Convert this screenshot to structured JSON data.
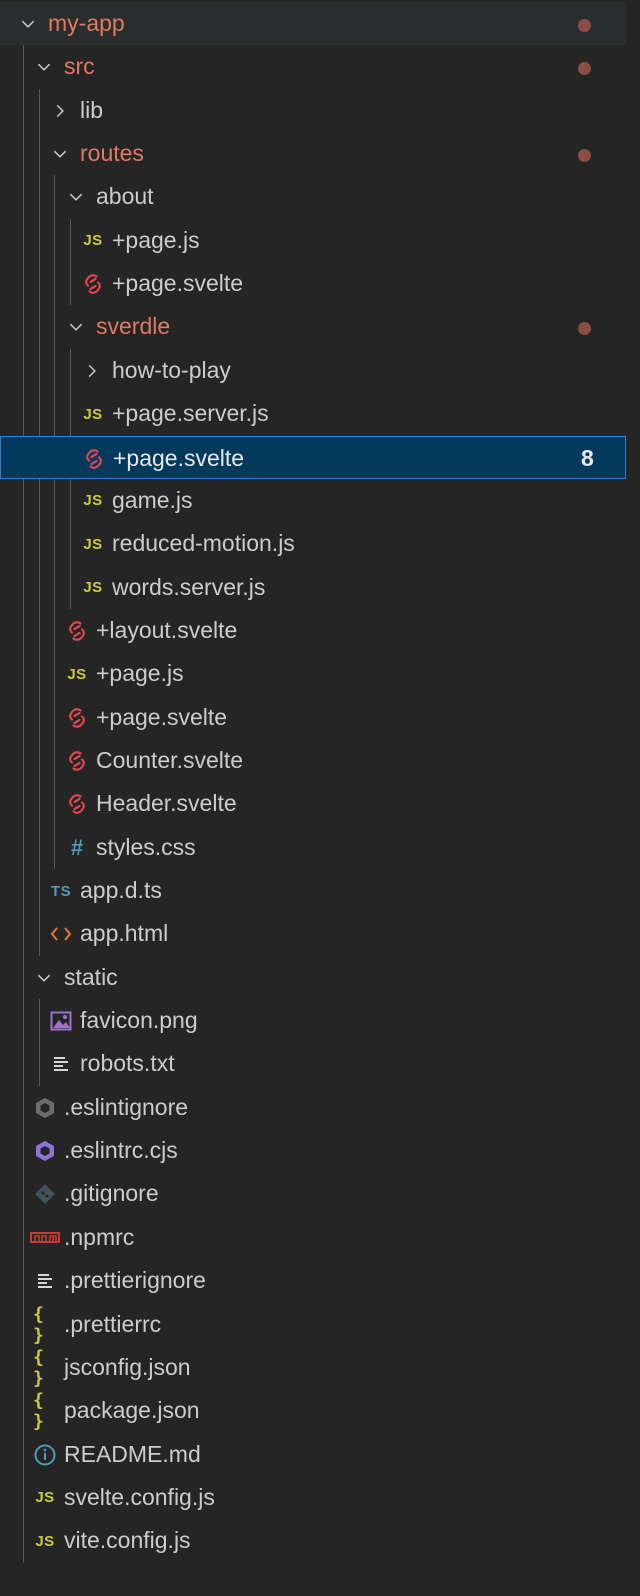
{
  "explorer": {
    "items": [
      {
        "label": "my-app",
        "icon": "chevron-down-icon",
        "kind": "folder-open",
        "modified": true,
        "dot": true
      },
      {
        "label": "src",
        "icon": "chevron-down-icon",
        "kind": "folder-open",
        "modified": true,
        "dot": true
      },
      {
        "label": "lib",
        "icon": "chevron-right-icon",
        "kind": "folder-closed"
      },
      {
        "label": "routes",
        "icon": "chevron-down-icon",
        "kind": "folder-open",
        "modified": true,
        "dot": true
      },
      {
        "label": "about",
        "icon": "chevron-down-icon",
        "kind": "folder-open"
      },
      {
        "label": "+page.js",
        "icon": "js-file-icon",
        "kind": "file"
      },
      {
        "label": "+page.svelte",
        "icon": "svelte-file-icon",
        "kind": "file"
      },
      {
        "label": "sverdle",
        "icon": "chevron-down-icon",
        "kind": "folder-open",
        "modified": true,
        "dot": true
      },
      {
        "label": "how-to-play",
        "icon": "chevron-right-icon",
        "kind": "folder-closed"
      },
      {
        "label": "+page.server.js",
        "icon": "js-file-icon",
        "kind": "file"
      },
      {
        "label": "+page.svelte",
        "icon": "svelte-file-icon",
        "kind": "file",
        "selected": true,
        "badge": "8"
      },
      {
        "label": "game.js",
        "icon": "js-file-icon",
        "kind": "file"
      },
      {
        "label": "reduced-motion.js",
        "icon": "js-file-icon",
        "kind": "file"
      },
      {
        "label": "words.server.js",
        "icon": "js-file-icon",
        "kind": "file"
      },
      {
        "label": "+layout.svelte",
        "icon": "svelte-file-icon",
        "kind": "file"
      },
      {
        "label": "+page.js",
        "icon": "js-file-icon",
        "kind": "file"
      },
      {
        "label": "+page.svelte",
        "icon": "svelte-file-icon",
        "kind": "file"
      },
      {
        "label": "Counter.svelte",
        "icon": "svelte-file-icon",
        "kind": "file"
      },
      {
        "label": "Header.svelte",
        "icon": "svelte-file-icon",
        "kind": "file"
      },
      {
        "label": "styles.css",
        "icon": "css-file-icon",
        "kind": "file"
      },
      {
        "label": "app.d.ts",
        "icon": "ts-file-icon",
        "kind": "file"
      },
      {
        "label": "app.html",
        "icon": "html-file-icon",
        "kind": "file"
      },
      {
        "label": "static",
        "icon": "chevron-down-icon",
        "kind": "folder-open"
      },
      {
        "label": "favicon.png",
        "icon": "image-file-icon",
        "kind": "file"
      },
      {
        "label": "robots.txt",
        "icon": "text-file-icon",
        "kind": "file"
      },
      {
        "label": ".eslintignore",
        "icon": "eslint-ignore-icon",
        "kind": "file"
      },
      {
        "label": ".eslintrc.cjs",
        "icon": "eslint-icon",
        "kind": "file"
      },
      {
        "label": ".gitignore",
        "icon": "git-icon",
        "kind": "file"
      },
      {
        "label": ".npmrc",
        "icon": "npm-icon",
        "kind": "file"
      },
      {
        "label": ".prettierignore",
        "icon": "text-file-icon",
        "kind": "file"
      },
      {
        "label": ".prettierrc",
        "icon": "json-braces-icon",
        "kind": "file"
      },
      {
        "label": "jsconfig.json",
        "icon": "json-braces-icon",
        "kind": "file"
      },
      {
        "label": "package.json",
        "icon": "json-braces-icon",
        "kind": "file"
      },
      {
        "label": "README.md",
        "icon": "info-icon",
        "kind": "file"
      },
      {
        "label": "svelte.config.js",
        "icon": "js-file-icon",
        "kind": "file"
      },
      {
        "label": "vite.config.js",
        "icon": "js-file-icon",
        "kind": "file"
      }
    ],
    "icon_text": {
      "js": "JS",
      "ts": "TS",
      "css": "#",
      "json": "{ }"
    },
    "colors": {
      "background": "#252526",
      "selected_bg": "#04395e",
      "selected_border": "#2f7fd8",
      "modified_text": "#e07960",
      "modified_dot": "#8a4e45",
      "js_icon": "#cbcb41",
      "svelte_icon": "#e0474c",
      "ts_icon": "#519aba",
      "html_icon": "#e37933",
      "eslint_icon": "#8f74d6",
      "npm_icon": "#cb3837"
    }
  }
}
